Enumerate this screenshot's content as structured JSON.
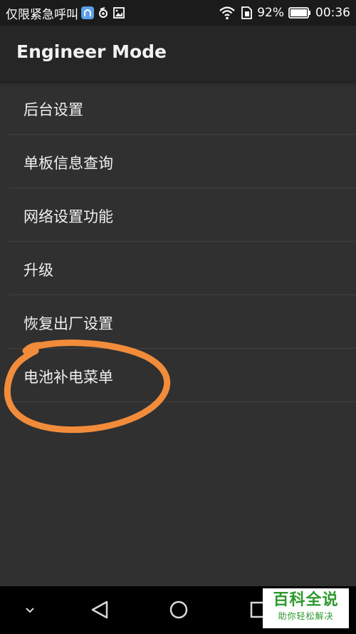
{
  "status_bar": {
    "carrier_text": "仅限紧急呼叫",
    "battery_percent": "92%",
    "time": "00:36",
    "icons": [
      "app-badge-icon",
      "sync-icon",
      "image-icon",
      "wifi-icon",
      "sim-icon",
      "battery-icon"
    ]
  },
  "app_bar": {
    "title": "Engineer Mode"
  },
  "menu": {
    "items": [
      {
        "label": "后台设置"
      },
      {
        "label": "单板信息查询"
      },
      {
        "label": "网络设置功能"
      },
      {
        "label": "升级"
      },
      {
        "label": "恢复出厂设置"
      },
      {
        "label": "电池补电菜单"
      }
    ]
  },
  "annotation": {
    "color": "#f28c3a",
    "target": "电池补电菜单"
  },
  "nav_bar": {
    "buttons": [
      "chevron-down-icon",
      "back-icon",
      "home-icon",
      "recents-icon"
    ]
  },
  "watermark": {
    "title": "百科全说",
    "subtitle": "助你轻松解决",
    "color": "#2d9a2d"
  },
  "colors": {
    "background": "#303030",
    "app_bar": "#262626",
    "status_bar": "#1b1b1b",
    "divider": "#414141",
    "text": "#f0f0f0"
  }
}
